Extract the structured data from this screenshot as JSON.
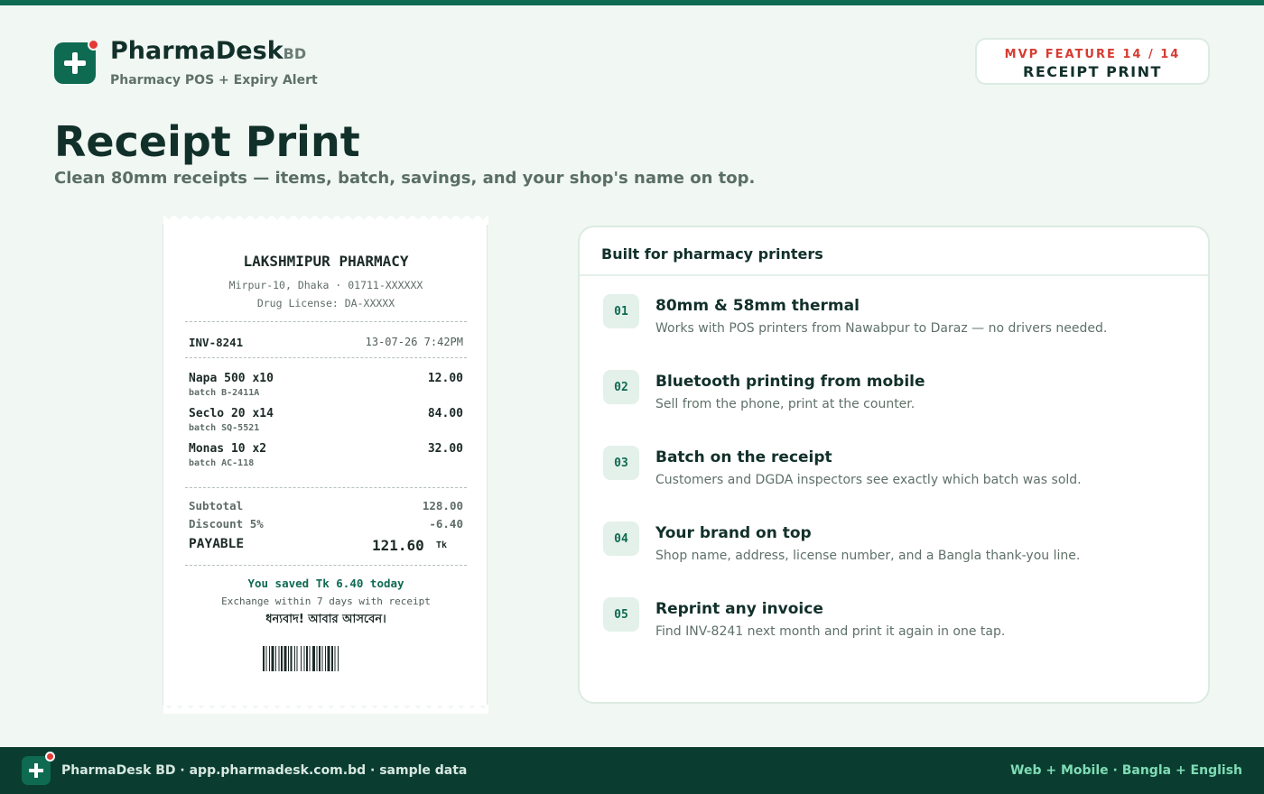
{
  "brand": {
    "name": "PharmaDesk",
    "suffix": "BD",
    "tagline": "Pharmacy POS + Expiry Alert"
  },
  "badge": {
    "kicker": "MVP FEATURE 14 / 14",
    "label": "RECEIPT PRINT"
  },
  "page": {
    "title": "Receipt Print",
    "subtitle": "Clean 80mm receipts — items, batch, savings, and your shop's name on top."
  },
  "receipt": {
    "shop": "LAKSHMIPUR PHARMACY",
    "address": "Mirpur-10, Dhaka · 01711-XXXXXX",
    "license": "Drug License: DA-XXXXX",
    "invoice": "INV-8241",
    "datetime": "13-07-26 7:42PM",
    "items": [
      {
        "name": "Napa 500 x10",
        "price": "12.00",
        "batch": "batch B-2411A"
      },
      {
        "name": "Seclo 20 x14",
        "price": "84.00",
        "batch": "batch SQ-5521"
      },
      {
        "name": "Monas 10 x2",
        "price": "32.00",
        "batch": "batch AC-118"
      }
    ],
    "subtotal_label": "Subtotal",
    "subtotal": "128.00",
    "discount_label": "Discount 5%",
    "discount": "-6.40",
    "payable_label": "PAYABLE",
    "payable": "121.60",
    "currency": "Tk",
    "saved": "You saved Tk 6.40 today",
    "exchange": "Exchange within 7 days with receipt",
    "thanks": "ধন্যবাদ! আবার আসবেন।"
  },
  "features": {
    "heading": "Built for pharmacy printers",
    "items": [
      {
        "num": "01",
        "title": "80mm & 58mm thermal",
        "desc": "Works with POS printers from Nawabpur to Daraz — no drivers needed."
      },
      {
        "num": "02",
        "title": "Bluetooth printing from mobile",
        "desc": "Sell from the phone, print at the counter."
      },
      {
        "num": "03",
        "title": "Batch on the receipt",
        "desc": "Customers and DGDA inspectors see exactly which batch was sold."
      },
      {
        "num": "04",
        "title": "Your brand on top",
        "desc": "Shop name, address, license number, and a Bangla thank-you line."
      },
      {
        "num": "05",
        "title": "Reprint any invoice",
        "desc": "Find INV-8241 next month and print it again in one tap."
      }
    ]
  },
  "footer": {
    "left": "PharmaDesk BD · app.pharmadesk.com.bd · sample data",
    "right": "Web + Mobile · Bangla + English"
  },
  "colors": {
    "brand": "#0f6a52",
    "accent": "#e53935",
    "footer": "#0a3d30"
  }
}
